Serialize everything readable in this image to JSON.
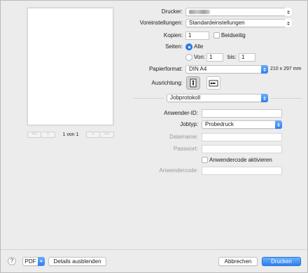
{
  "preview": {
    "first_label": "<<",
    "prev_label": "<",
    "page_count": "1 von 1",
    "next_label": ">",
    "last_label": ">>"
  },
  "printer": {
    "label": "Drucker:",
    "value_redacted": true
  },
  "presets": {
    "label": "Voreinstellungen:",
    "value": "Standardeinstellungen"
  },
  "copies": {
    "label": "Kopien:",
    "value": "1",
    "duplex_label": "Beidseitig",
    "duplex_checked": false
  },
  "pages": {
    "label": "Seiten:",
    "all_label": "Alle",
    "all_selected": true,
    "from_label": "Von:",
    "from_value": "1",
    "to_label": "bis:",
    "to_value": "1"
  },
  "paper": {
    "label": "Papierformat:",
    "value": "DIN A4",
    "dimensions": "210 x 297 mm"
  },
  "orientation": {
    "label": "Ausrichtung:",
    "selected": "portrait"
  },
  "section": {
    "value": "Jobprotokoll"
  },
  "job": {
    "user_id_label": "Anwender-ID:",
    "user_id_value": "",
    "job_type_label": "Jobtyp:",
    "job_type_value": "Probedruck",
    "filename_label": "Dateiname:",
    "filename_value": "",
    "password_label": "Passwort:",
    "password_value": "",
    "usercode_checkbox_label": "Anwendercode aktivieren",
    "usercode_checked": false,
    "usercode_label": "Anwendercode:",
    "usercode_value": ""
  },
  "footer": {
    "help_label": "?",
    "pdf_label": "PDF",
    "details_label": "Details ausblenden",
    "cancel_label": "Abbrechen",
    "print_label": "Drucken"
  },
  "colors": {
    "accent": "#2f7ef0",
    "background": "#ececec"
  }
}
